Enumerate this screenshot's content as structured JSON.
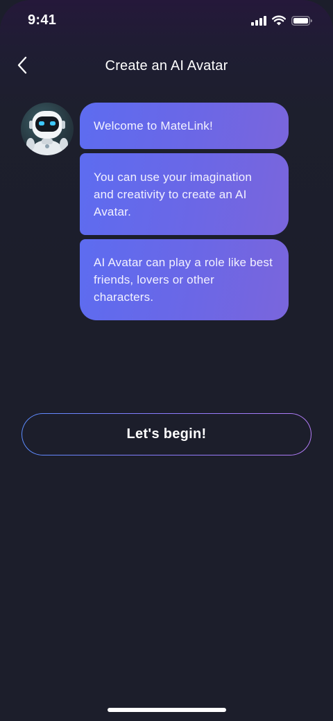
{
  "status_bar": {
    "time": "9:41",
    "icons": [
      "signal-icon",
      "wifi-icon",
      "battery-icon"
    ]
  },
  "nav": {
    "back_icon": "chevron-left-icon",
    "title": "Create an AI Avatar"
  },
  "chat": {
    "avatar_icon": "robot-avatar",
    "messages": [
      "Welcome to MateLink!",
      "You can use your imagination and creativity to create an AI Avatar.",
      "AI Avatar can play a role like best friends, lovers or other characters."
    ]
  },
  "action": {
    "begin_label": "Let's begin!"
  },
  "colors": {
    "background": "#1c1e2b",
    "bubble_start": "#5d6cf0",
    "bubble_end": "#7a66dc",
    "button_border_start": "#5b8cff",
    "button_border_end": "#b37cf6"
  }
}
